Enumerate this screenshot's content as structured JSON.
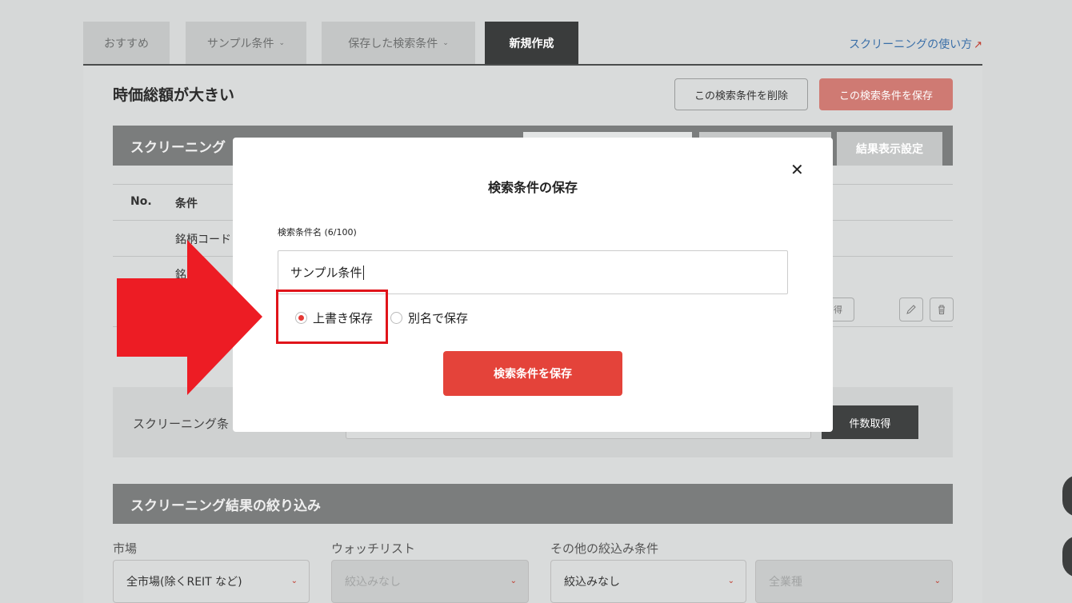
{
  "tabs": [
    {
      "label": "おすすめ"
    },
    {
      "label": "サンプル条件",
      "chevron": "⌄"
    },
    {
      "label": "保存した検索条件",
      "chevron": "⌄"
    },
    {
      "label": "新規作成"
    }
  ],
  "help_link": {
    "label": "スクリーニングの使い方",
    "icon": "external-link-icon",
    "glyph": "↗"
  },
  "page": {
    "title": "時価総額が大きい",
    "delete_button": "この検索条件を削除",
    "save_button": "この検索条件を保存"
  },
  "criteria_section": {
    "title": "スクリーニング",
    "tab_right": "結果表示設定",
    "table_headers": {
      "no": "No.",
      "condition": "条件"
    },
    "rows": [
      {
        "condition": "銘柄コード"
      },
      {
        "condition": "銘"
      }
    ],
    "row_button": "得"
  },
  "count_area": {
    "label": "スクリーニング条",
    "button": "件数取得"
  },
  "filter_section": {
    "title": "スクリーニング結果の絞り込み",
    "labels": {
      "market": "市場",
      "watchlist": "ウォッチリスト",
      "other": "その他の絞込み条件"
    },
    "selects": {
      "market": "全市場(除くREIT など)",
      "watchlist": "絞込みなし",
      "other": "絞込みなし",
      "industry": "全業種"
    }
  },
  "modal": {
    "title": "検索条件の保存",
    "close_glyph": "✕",
    "name_label": "検索条件名 (6/100)",
    "name_value": "サンプル条件",
    "radio_overwrite": "上書き保存",
    "radio_saveas": "別名で保存",
    "radio_selected": "overwrite",
    "submit": "検索条件を保存"
  },
  "colors": {
    "accent": "#e4433a",
    "highlight": "#e0141a",
    "tab_active": "#3a3c3c",
    "link": "#3a6fa8"
  }
}
